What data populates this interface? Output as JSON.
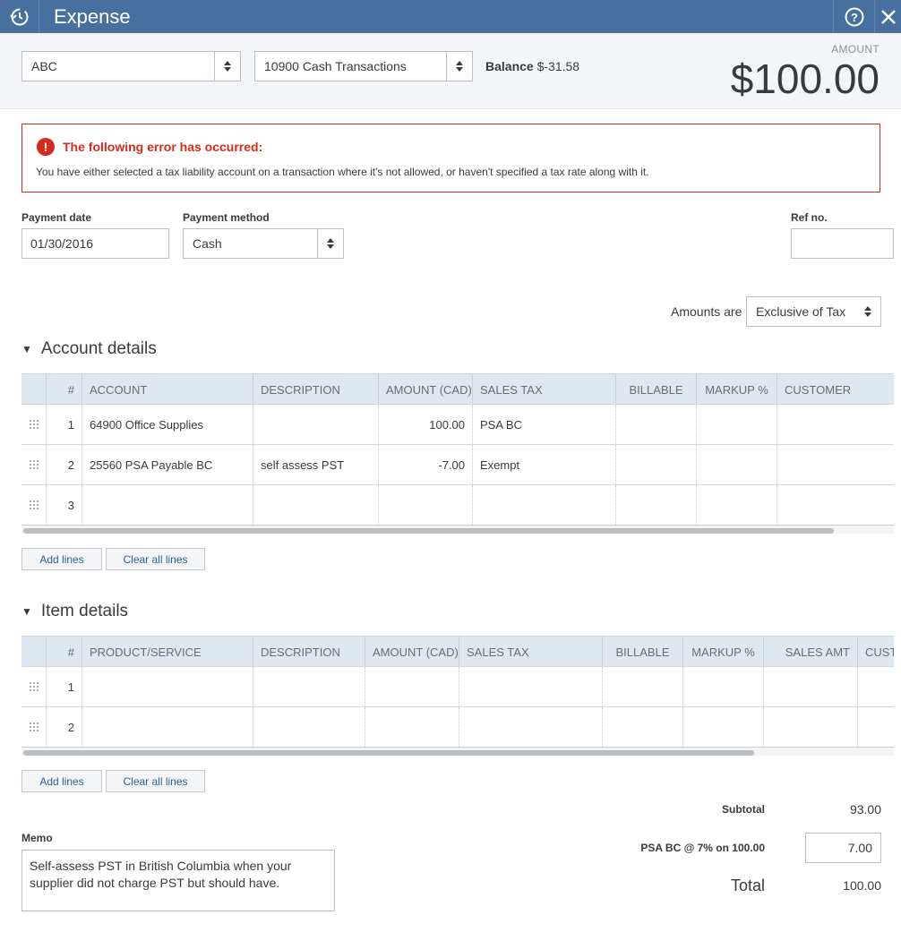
{
  "window": {
    "title": "Expense"
  },
  "header": {
    "payee": "ABC",
    "account": "10900 Cash Transactions",
    "balance_label": "Balance",
    "balance_value": "$-31.58",
    "amount_label": "AMOUNT",
    "amount_value": "$100.00"
  },
  "error": {
    "title": "The following error has occurred:",
    "message": "You have either selected a tax liability account on a transaction where it's not allowed, or haven't specified a tax rate along with it."
  },
  "form": {
    "payment_date_label": "Payment date",
    "payment_date": "01/30/2016",
    "payment_method_label": "Payment method",
    "payment_method": "Cash",
    "ref_label": "Ref no.",
    "ref_value": "",
    "amounts_are_label": "Amounts are",
    "amounts_are_value": "Exclusive of Tax"
  },
  "account_details": {
    "title": "Account details",
    "columns": [
      "#",
      "ACCOUNT",
      "DESCRIPTION",
      "AMOUNT (CAD)",
      "SALES TAX",
      "BILLABLE",
      "MARKUP %",
      "CUSTOMER"
    ],
    "rows": [
      {
        "num": "1",
        "account": "64900 Office Supplies",
        "description": "",
        "amount": "100.00",
        "tax": "PSA BC"
      },
      {
        "num": "2",
        "account": "25560 PSA Payable BC",
        "description": "self assess PST",
        "amount": "-7.00",
        "tax": "Exempt"
      },
      {
        "num": "3",
        "account": "",
        "description": "",
        "amount": "",
        "tax": ""
      }
    ],
    "add_lines": "Add lines",
    "clear_lines": "Clear all lines"
  },
  "item_details": {
    "title": "Item details",
    "columns": [
      "#",
      "PRODUCT/SERVICE",
      "DESCRIPTION",
      "AMOUNT (CAD)",
      "SALES TAX",
      "BILLABLE",
      "MARKUP %",
      "SALES AMT",
      "CUST"
    ],
    "rows": [
      {
        "num": "1"
      },
      {
        "num": "2"
      }
    ],
    "add_lines": "Add lines",
    "clear_lines": "Clear all lines"
  },
  "totals": {
    "subtotal_label": "Subtotal",
    "subtotal_value": "93.00",
    "tax_label": "PSA BC @ 7% on 100.00",
    "tax_value": "7.00",
    "total_label": "Total",
    "total_value": "100.00"
  },
  "memo": {
    "label": "Memo",
    "text": "Self-assess PST in British Columbia when your supplier did not charge PST but should have."
  },
  "colors": {
    "titlebar": "#47709e",
    "error": "#d52b1e",
    "table_header": "#dfe7f1",
    "link": "#2a5e9b"
  }
}
